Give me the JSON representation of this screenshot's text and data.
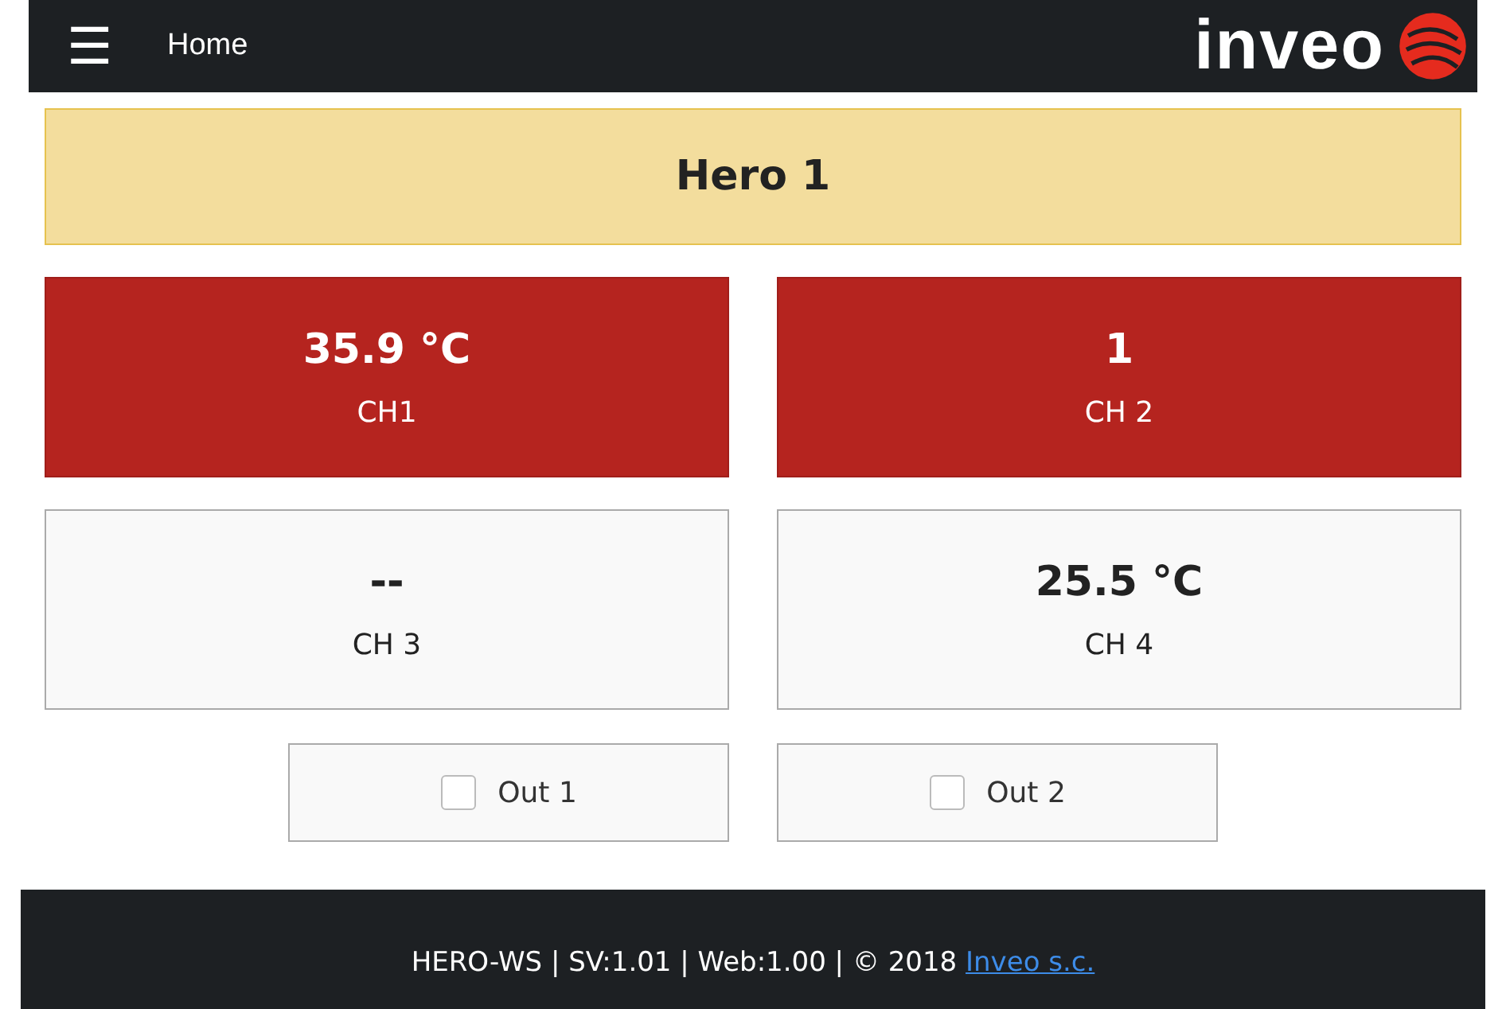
{
  "navbar": {
    "menu_icon": "☰",
    "title": "Home",
    "logo": "inveo"
  },
  "header": {
    "title": "Hero 1"
  },
  "channels": [
    {
      "value": "35.9 °C",
      "label": "CH1",
      "alarm": true
    },
    {
      "value": "1",
      "label": "CH 2",
      "alarm": true
    },
    {
      "value": "--",
      "label": "CH 3",
      "alarm": false
    },
    {
      "value": "25.5 °C",
      "label": "CH 4",
      "alarm": false
    }
  ],
  "outputs": [
    {
      "label": "Out 1",
      "checked": false
    },
    {
      "label": "Out 2",
      "checked": false
    }
  ],
  "footer": {
    "text": "HERO-WS | SV:1.01 | Web:1.00 | © 2018 ",
    "link": "Inveo s.c."
  }
}
